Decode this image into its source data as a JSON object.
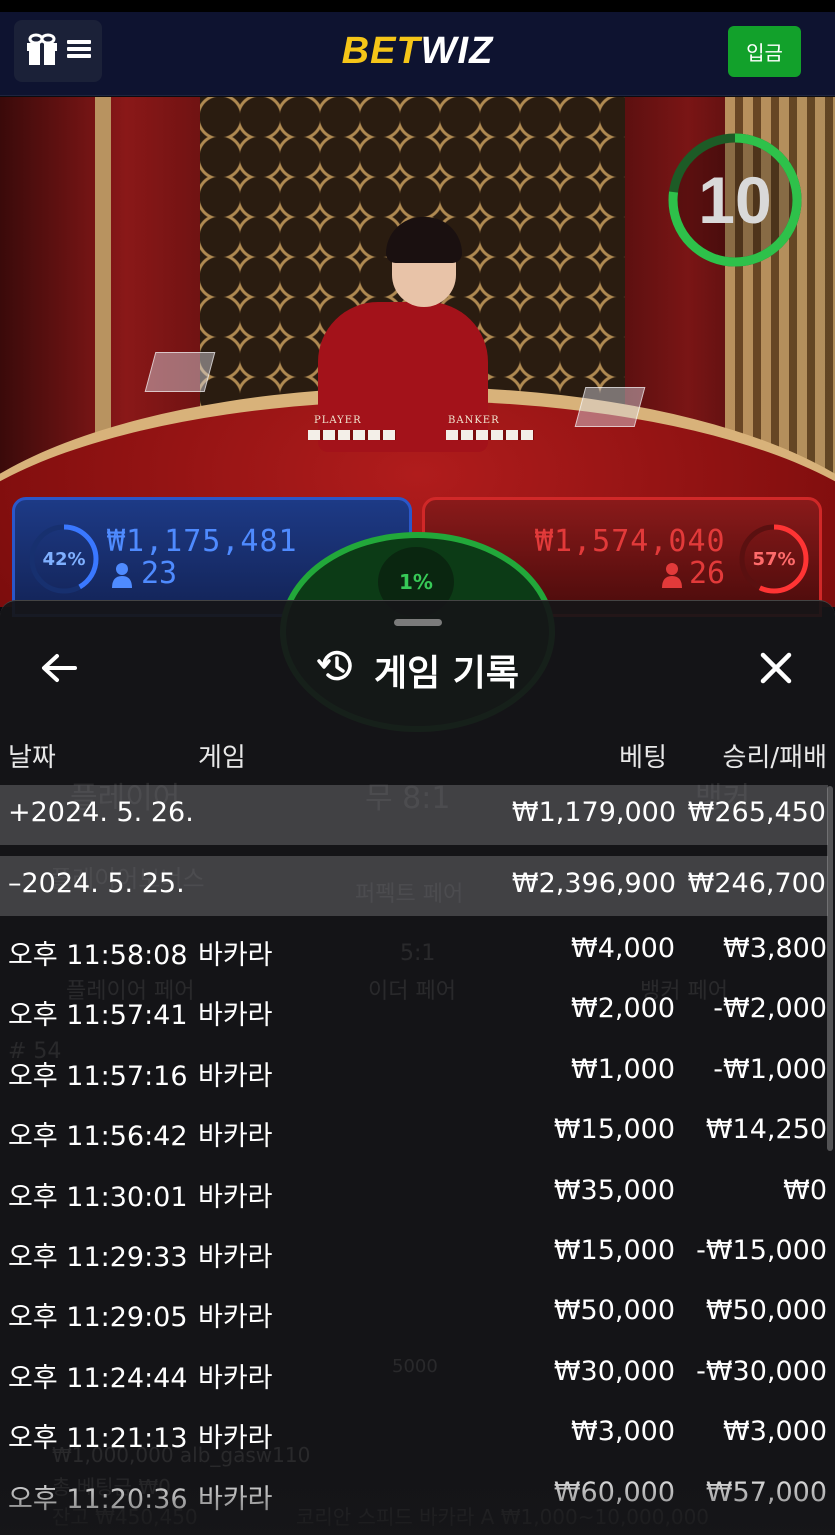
{
  "header": {
    "logo_bet": "BET",
    "logo_wiz": "WIZ",
    "deposit_label": "입금",
    "menu_icons": [
      "gift-icon",
      "hamburger-icon"
    ]
  },
  "live": {
    "timer": "10",
    "card_labels": {
      "player": "PLAYER",
      "banker": "BANKER"
    },
    "player": {
      "percent": "42%",
      "amount": "₩1,175,481",
      "count": "23"
    },
    "banker": {
      "percent": "57%",
      "amount": "₩1,574,040",
      "count": "26"
    },
    "tie": {
      "percent": "1%"
    }
  },
  "history": {
    "title": "게임 기록",
    "columns": {
      "date": "날짜",
      "game": "게임",
      "bet": "베팅",
      "result": "승리/패배"
    },
    "days": [
      {
        "date": "+2024. 5. 26.",
        "bet": "₩1,179,000",
        "result": "₩265,450"
      },
      {
        "date": "–2024. 5. 25.",
        "bet": "₩2,396,900",
        "result": "₩246,700"
      }
    ],
    "rows": [
      {
        "time": "오후 11:58:08",
        "game": "바카라",
        "bet": "₩4,000",
        "result": "₩3,800"
      },
      {
        "time": "오후 11:57:41",
        "game": "바카라",
        "bet": "₩2,000",
        "result": "-₩2,000"
      },
      {
        "time": "오후 11:57:16",
        "game": "바카라",
        "bet": "₩1,000",
        "result": "-₩1,000"
      },
      {
        "time": "오후 11:56:42",
        "game": "바카라",
        "bet": "₩15,000",
        "result": "₩14,250"
      },
      {
        "time": "오후 11:30:01",
        "game": "바카라",
        "bet": "₩35,000",
        "result": "₩0"
      },
      {
        "time": "오후 11:29:33",
        "game": "바카라",
        "bet": "₩15,000",
        "result": "-₩15,000"
      },
      {
        "time": "오후 11:29:05",
        "game": "바카라",
        "bet": "₩50,000",
        "result": "₩50,000"
      },
      {
        "time": "오후 11:24:44",
        "game": "바카라",
        "bet": "₩30,000",
        "result": "-₩30,000"
      },
      {
        "time": "오후 11:21:13",
        "game": "바카라",
        "bet": "₩3,000",
        "result": "₩3,000"
      },
      {
        "time": "오후 11:20:36",
        "game": "바카라",
        "bet": "₩60,000",
        "result": "₩57,000"
      }
    ]
  },
  "background_ghost": {
    "player_label": "플레이어",
    "tie_label": "무 8:1",
    "banker_label": "뱅커",
    "bonus_label": "플레이어보너스",
    "perfect_pair": "퍼펙트 페어",
    "either_pair_odds": "5:1",
    "either_pair": "이더 페어",
    "player_pair": "플레이어 페어",
    "banker_pair": "뱅커 페어",
    "round": "# 54",
    "chip": "5000",
    "footer_user": "₩1,000,000 alb_gasw110",
    "footer_total": "총 베팅금 ₩0",
    "footer_balance": "잔고 ₩450,450",
    "footer_table": "코리안 스피드 바카라 A ₩1,000~10,000,000"
  },
  "colors": {
    "player_blue": "#2b57c9",
    "banker_red": "#d02828",
    "tie_green": "#22a83a",
    "deposit_green": "#12a12b",
    "brand_yellow": "#f5c518"
  }
}
